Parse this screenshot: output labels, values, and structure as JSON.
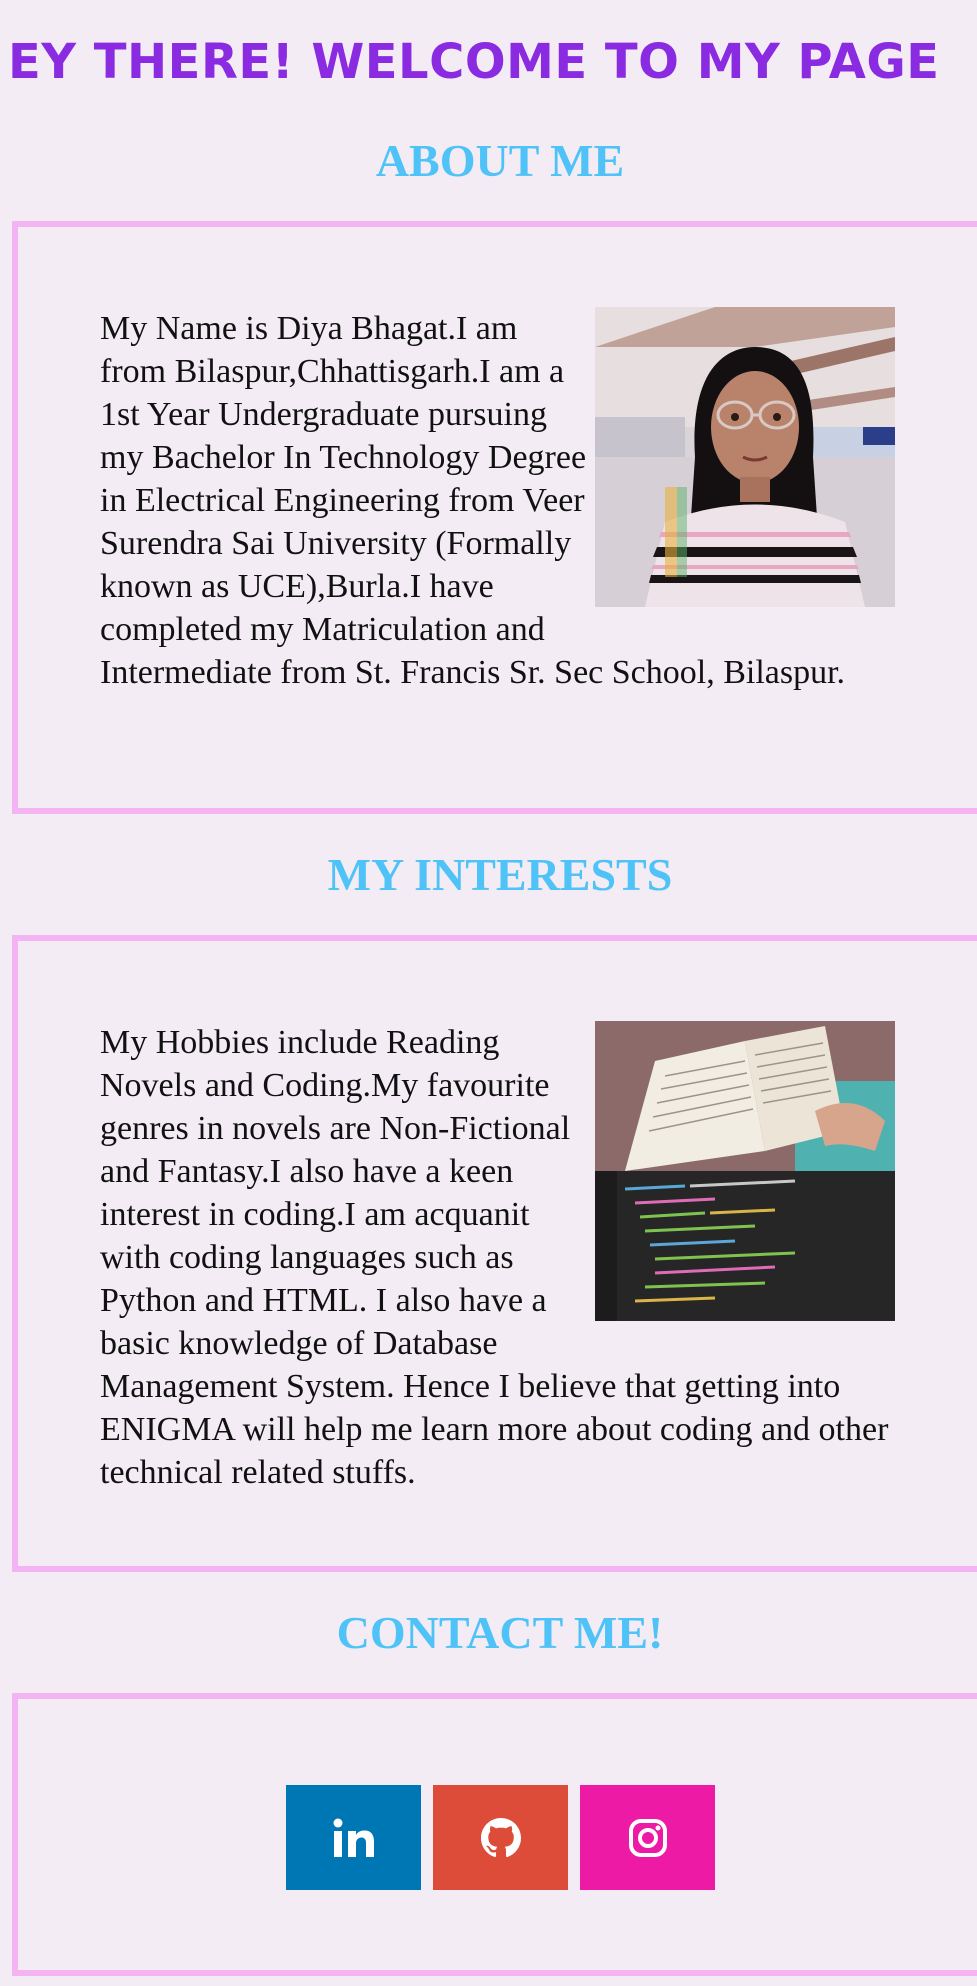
{
  "header": {
    "title": "EY THERE! WELCOME TO MY PAGE"
  },
  "about": {
    "title": "ABOUT ME",
    "text": "My Name is Diya Bhagat.I am from Bilaspur,Chhattisgarh.I am a 1st Year Undergraduate pursuing my Bachelor In Technology Degree in Electrical Engineering from Veer Surendra Sai University (Formally known as UCE),Burla.I have completed my Matriculation and Intermediate from St. Francis Sr. Sec School, Bilaspur."
  },
  "interests": {
    "title": "MY INTERESTS",
    "text": "My Hobbies include Reading Novels and Coding.My favourite genres in novels are Non-Fictional and Fantasy.I also have a keen interest in coding.I am acquanit with coding languages such as Python and HTML. I also have a basic knowledge of Database Management System. Hence I believe that getting into ENIGMA will help me learn more about coding and other technical related stuffs."
  },
  "contact": {
    "title": "CONTACT ME!",
    "links": [
      {
        "name": "linkedin",
        "icon": "linkedin-icon",
        "color": "#0077b5"
      },
      {
        "name": "github",
        "icon": "github-icon",
        "color": "#dd4b39"
      },
      {
        "name": "instagram",
        "icon": "instagram-icon",
        "color": "#ed1aa6"
      }
    ]
  },
  "colors": {
    "background": "#f3ecf4",
    "header": "#8a2be2",
    "section_title": "#4fc3f7",
    "border": "#f4b4f4"
  }
}
